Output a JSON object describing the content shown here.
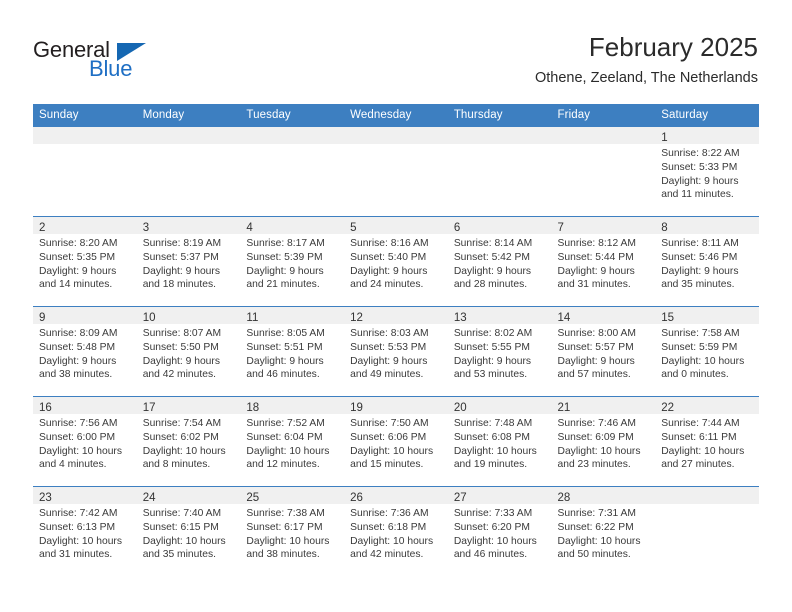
{
  "logo": {
    "word_top": "General",
    "word_bottom": "Blue",
    "accent_color": "#1567b2"
  },
  "header": {
    "title": "February 2025",
    "subtitle": "Othene, Zeeland, The Netherlands",
    "header_bg_color": "#3d7fc1"
  },
  "weekdays": [
    "Sunday",
    "Monday",
    "Tuesday",
    "Wednesday",
    "Thursday",
    "Friday",
    "Saturday"
  ],
  "labels": {
    "sunrise": "Sunrise:",
    "sunset": "Sunset:",
    "daylight": "Daylight:"
  },
  "weeks": [
    [
      {
        "day": ""
      },
      {
        "day": ""
      },
      {
        "day": ""
      },
      {
        "day": ""
      },
      {
        "day": ""
      },
      {
        "day": ""
      },
      {
        "day": "1",
        "sunrise": "Sunrise: 8:22 AM",
        "sunset": "Sunset: 5:33 PM",
        "daylight": "Daylight: 9 hours and 11 minutes."
      }
    ],
    [
      {
        "day": "2",
        "sunrise": "Sunrise: 8:20 AM",
        "sunset": "Sunset: 5:35 PM",
        "daylight": "Daylight: 9 hours and 14 minutes."
      },
      {
        "day": "3",
        "sunrise": "Sunrise: 8:19 AM",
        "sunset": "Sunset: 5:37 PM",
        "daylight": "Daylight: 9 hours and 18 minutes."
      },
      {
        "day": "4",
        "sunrise": "Sunrise: 8:17 AM",
        "sunset": "Sunset: 5:39 PM",
        "daylight": "Daylight: 9 hours and 21 minutes."
      },
      {
        "day": "5",
        "sunrise": "Sunrise: 8:16 AM",
        "sunset": "Sunset: 5:40 PM",
        "daylight": "Daylight: 9 hours and 24 minutes."
      },
      {
        "day": "6",
        "sunrise": "Sunrise: 8:14 AM",
        "sunset": "Sunset: 5:42 PM",
        "daylight": "Daylight: 9 hours and 28 minutes."
      },
      {
        "day": "7",
        "sunrise": "Sunrise: 8:12 AM",
        "sunset": "Sunset: 5:44 PM",
        "daylight": "Daylight: 9 hours and 31 minutes."
      },
      {
        "day": "8",
        "sunrise": "Sunrise: 8:11 AM",
        "sunset": "Sunset: 5:46 PM",
        "daylight": "Daylight: 9 hours and 35 minutes."
      }
    ],
    [
      {
        "day": "9",
        "sunrise": "Sunrise: 8:09 AM",
        "sunset": "Sunset: 5:48 PM",
        "daylight": "Daylight: 9 hours and 38 minutes."
      },
      {
        "day": "10",
        "sunrise": "Sunrise: 8:07 AM",
        "sunset": "Sunset: 5:50 PM",
        "daylight": "Daylight: 9 hours and 42 minutes."
      },
      {
        "day": "11",
        "sunrise": "Sunrise: 8:05 AM",
        "sunset": "Sunset: 5:51 PM",
        "daylight": "Daylight: 9 hours and 46 minutes."
      },
      {
        "day": "12",
        "sunrise": "Sunrise: 8:03 AM",
        "sunset": "Sunset: 5:53 PM",
        "daylight": "Daylight: 9 hours and 49 minutes."
      },
      {
        "day": "13",
        "sunrise": "Sunrise: 8:02 AM",
        "sunset": "Sunset: 5:55 PM",
        "daylight": "Daylight: 9 hours and 53 minutes."
      },
      {
        "day": "14",
        "sunrise": "Sunrise: 8:00 AM",
        "sunset": "Sunset: 5:57 PM",
        "daylight": "Daylight: 9 hours and 57 minutes."
      },
      {
        "day": "15",
        "sunrise": "Sunrise: 7:58 AM",
        "sunset": "Sunset: 5:59 PM",
        "daylight": "Daylight: 10 hours and 0 minutes."
      }
    ],
    [
      {
        "day": "16",
        "sunrise": "Sunrise: 7:56 AM",
        "sunset": "Sunset: 6:00 PM",
        "daylight": "Daylight: 10 hours and 4 minutes."
      },
      {
        "day": "17",
        "sunrise": "Sunrise: 7:54 AM",
        "sunset": "Sunset: 6:02 PM",
        "daylight": "Daylight: 10 hours and 8 minutes."
      },
      {
        "day": "18",
        "sunrise": "Sunrise: 7:52 AM",
        "sunset": "Sunset: 6:04 PM",
        "daylight": "Daylight: 10 hours and 12 minutes."
      },
      {
        "day": "19",
        "sunrise": "Sunrise: 7:50 AM",
        "sunset": "Sunset: 6:06 PM",
        "daylight": "Daylight: 10 hours and 15 minutes."
      },
      {
        "day": "20",
        "sunrise": "Sunrise: 7:48 AM",
        "sunset": "Sunset: 6:08 PM",
        "daylight": "Daylight: 10 hours and 19 minutes."
      },
      {
        "day": "21",
        "sunrise": "Sunrise: 7:46 AM",
        "sunset": "Sunset: 6:09 PM",
        "daylight": "Daylight: 10 hours and 23 minutes."
      },
      {
        "day": "22",
        "sunrise": "Sunrise: 7:44 AM",
        "sunset": "Sunset: 6:11 PM",
        "daylight": "Daylight: 10 hours and 27 minutes."
      }
    ],
    [
      {
        "day": "23",
        "sunrise": "Sunrise: 7:42 AM",
        "sunset": "Sunset: 6:13 PM",
        "daylight": "Daylight: 10 hours and 31 minutes."
      },
      {
        "day": "24",
        "sunrise": "Sunrise: 7:40 AM",
        "sunset": "Sunset: 6:15 PM",
        "daylight": "Daylight: 10 hours and 35 minutes."
      },
      {
        "day": "25",
        "sunrise": "Sunrise: 7:38 AM",
        "sunset": "Sunset: 6:17 PM",
        "daylight": "Daylight: 10 hours and 38 minutes."
      },
      {
        "day": "26",
        "sunrise": "Sunrise: 7:36 AM",
        "sunset": "Sunset: 6:18 PM",
        "daylight": "Daylight: 10 hours and 42 minutes."
      },
      {
        "day": "27",
        "sunrise": "Sunrise: 7:33 AM",
        "sunset": "Sunset: 6:20 PM",
        "daylight": "Daylight: 10 hours and 46 minutes."
      },
      {
        "day": "28",
        "sunrise": "Sunrise: 7:31 AM",
        "sunset": "Sunset: 6:22 PM",
        "daylight": "Daylight: 10 hours and 50 minutes."
      },
      {
        "day": ""
      }
    ]
  ]
}
